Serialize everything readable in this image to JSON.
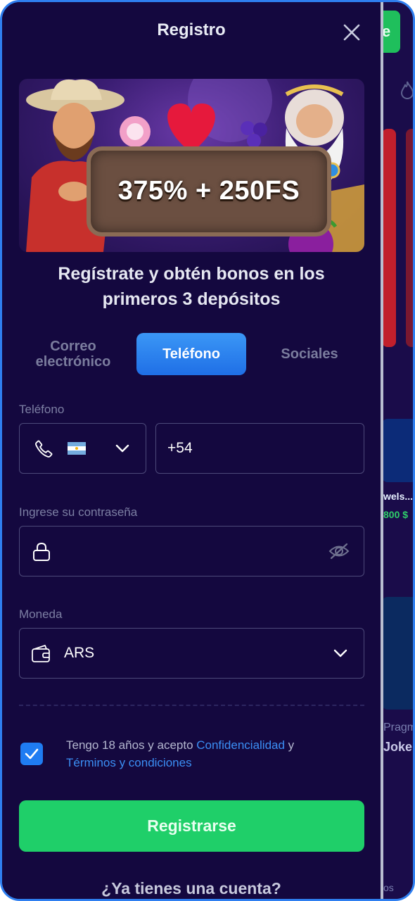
{
  "modal": {
    "title": "Registro",
    "banner_text": "375% + 250FS",
    "headline": "Regístrate y obtén bonos en los primeros 3 depósitos"
  },
  "tabs": [
    {
      "label": "Correo electrónico",
      "active": false
    },
    {
      "label": "Teléfono",
      "active": true
    },
    {
      "label": "Sociales",
      "active": false
    }
  ],
  "phone": {
    "label": "Teléfono",
    "country_flag": "argentina-flag",
    "value": "+54"
  },
  "password": {
    "label": "Ingrese su contraseña",
    "value": ""
  },
  "currency": {
    "label": "Moneda",
    "value": "ARS"
  },
  "terms": {
    "checked": true,
    "prefix": "Tengo 18 años y acepto ",
    "privacy_link": "Confidencialidad",
    "connector": " y",
    "terms_link": "Términos y condiciones"
  },
  "register_button": "Registrarse",
  "have_account": "¿Ya tienes una cuenta?",
  "colors": {
    "background": "#14083f",
    "accent_blue": "#2a85f2",
    "register_green": "#1fcf69",
    "frame_border": "#2f7ff0"
  }
}
